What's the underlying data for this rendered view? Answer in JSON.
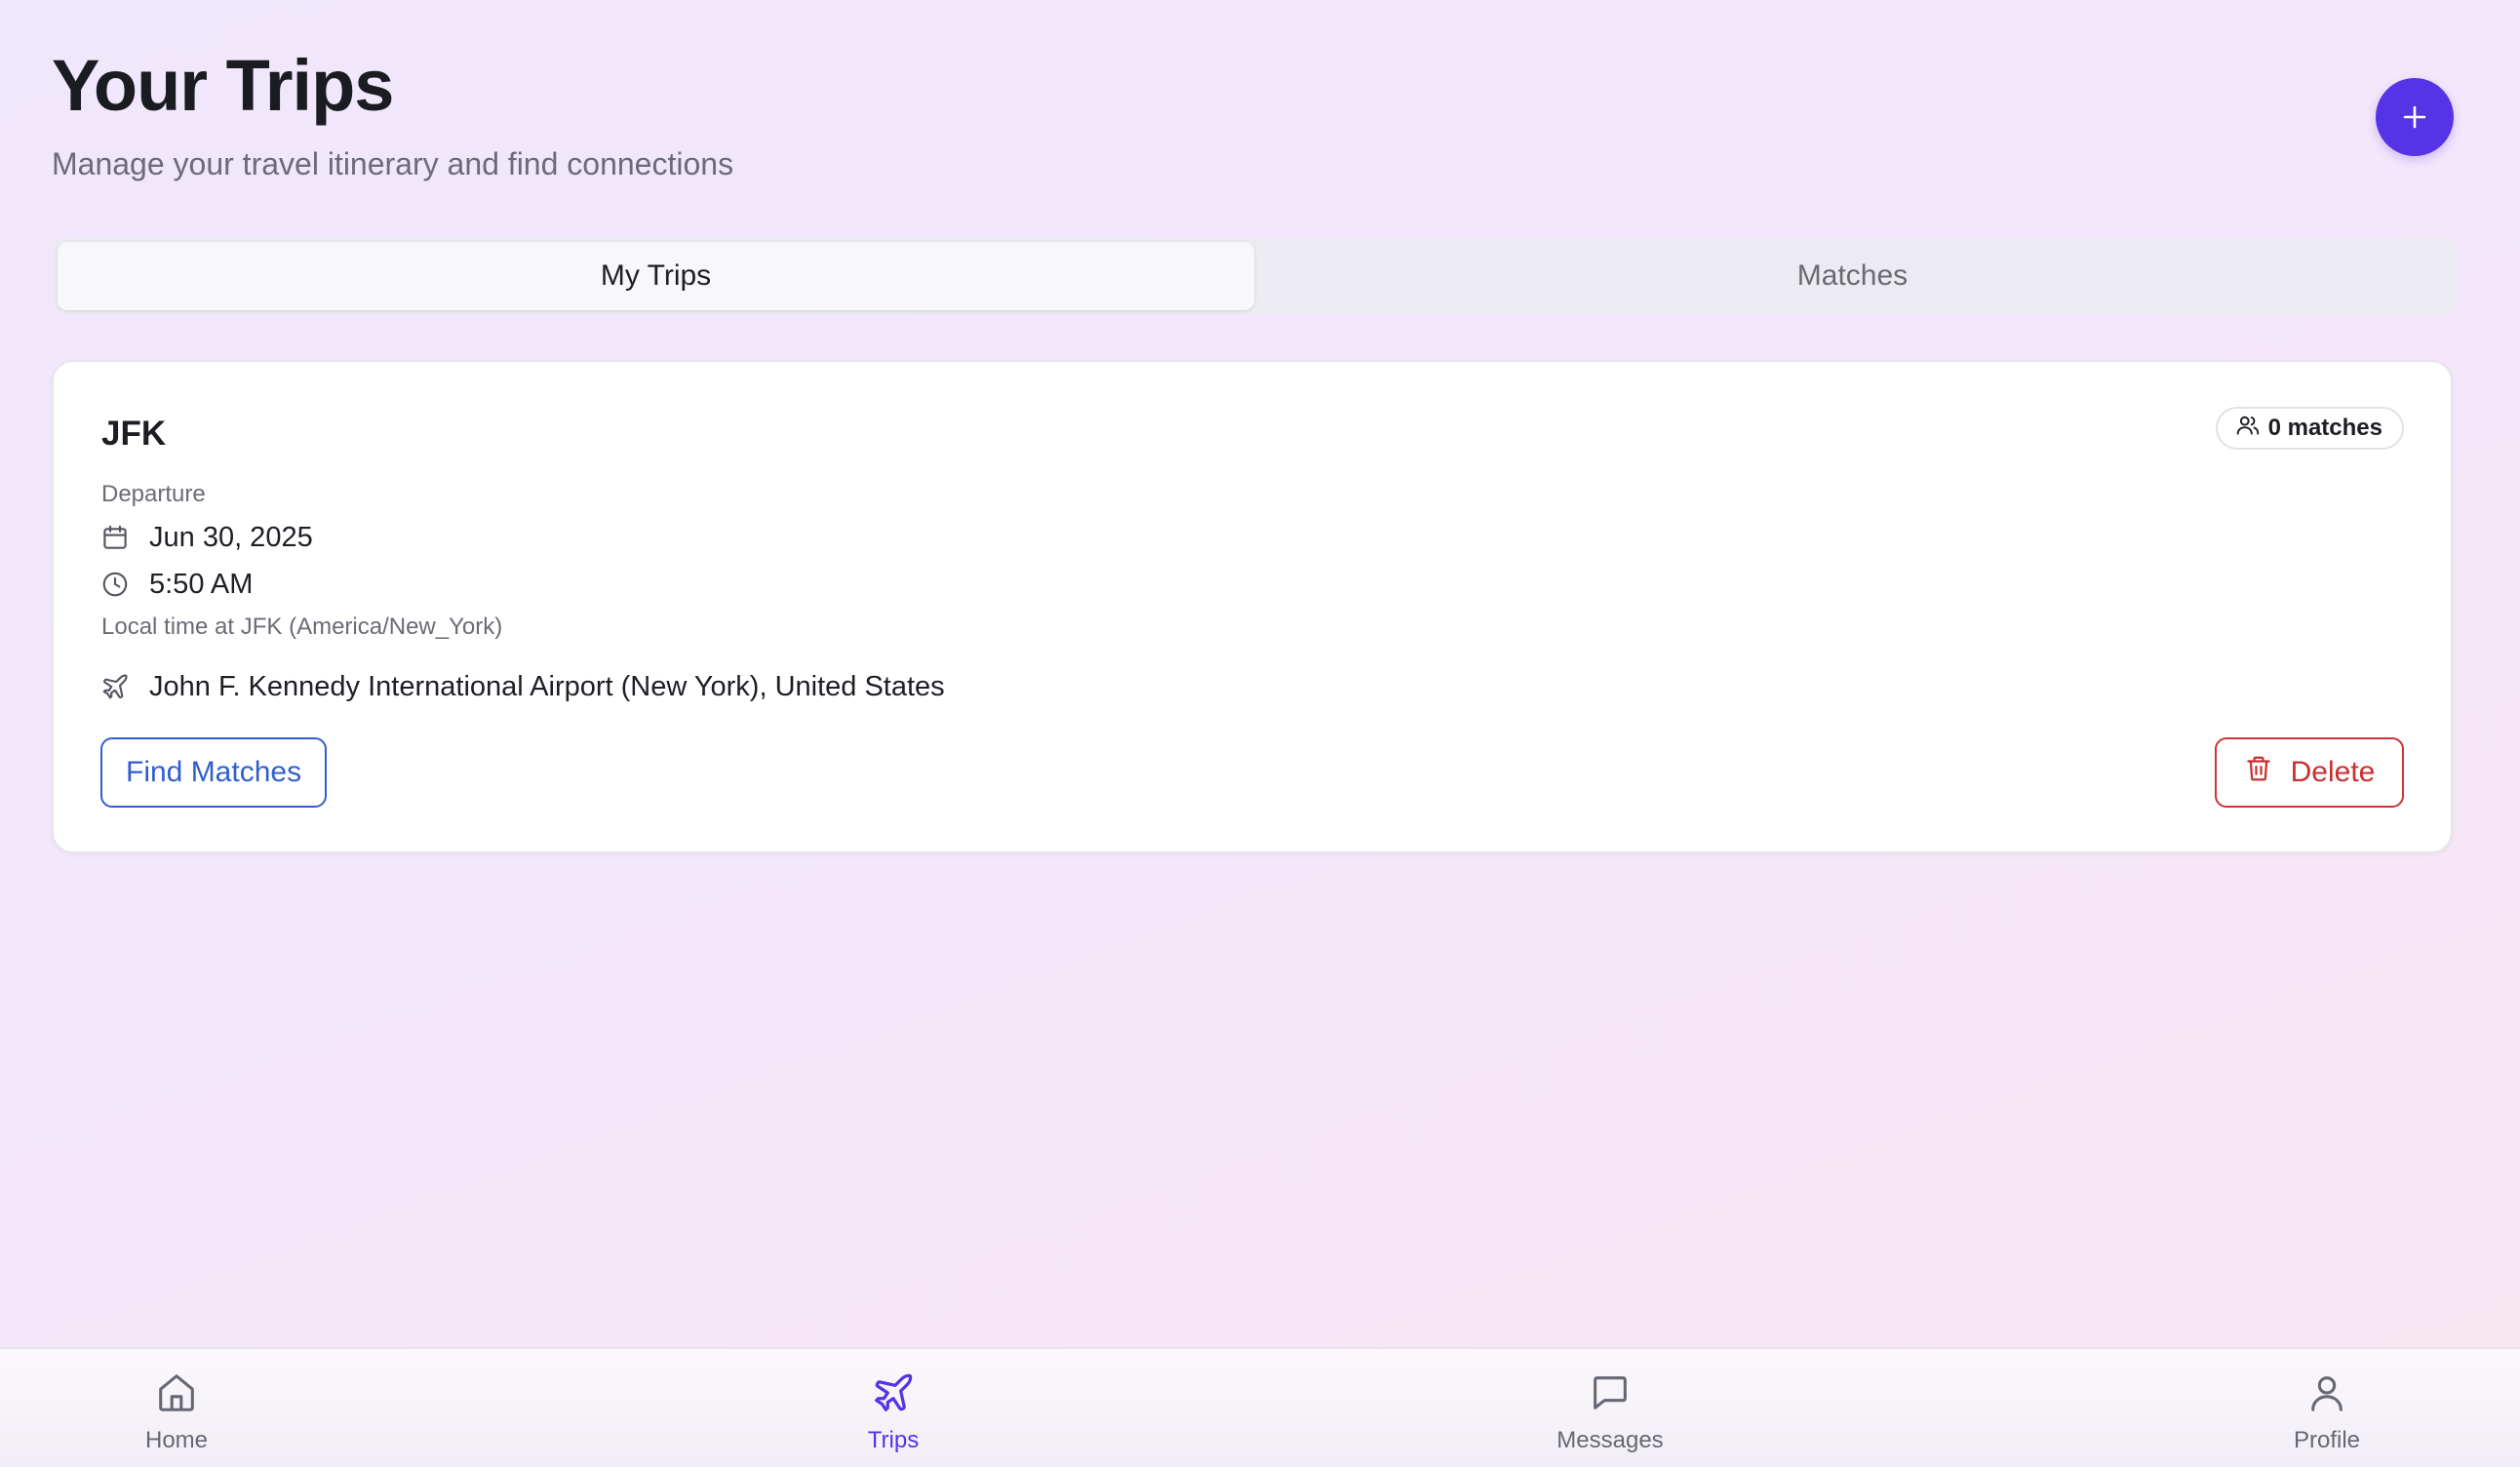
{
  "header": {
    "title": "Your Trips",
    "subtitle": "Manage your travel itinerary and find connections",
    "add_button_icon": "plus-icon"
  },
  "tabs": [
    {
      "label": "My Trips",
      "active": true
    },
    {
      "label": "Matches",
      "active": false
    }
  ],
  "trip": {
    "code": "JFK",
    "matches_label": "0 matches",
    "type_label": "Departure",
    "date": "Jun 30, 2025",
    "time": "5:50 AM",
    "local_time_note": "Local time at JFK (America/New_York)",
    "airport": "John F. Kennedy International Airport (New York), United States",
    "find_matches_label": "Find Matches",
    "delete_label": "Delete"
  },
  "nav": {
    "items": [
      {
        "label": "Home",
        "icon": "home-icon",
        "active": false
      },
      {
        "label": "Trips",
        "icon": "plane-icon",
        "active": true
      },
      {
        "label": "Messages",
        "icon": "message-icon",
        "active": false
      },
      {
        "label": "Profile",
        "icon": "user-icon",
        "active": false
      }
    ]
  },
  "colors": {
    "accent": "#5434e6",
    "link_blue": "#2f5fcf",
    "danger": "#c93030"
  }
}
